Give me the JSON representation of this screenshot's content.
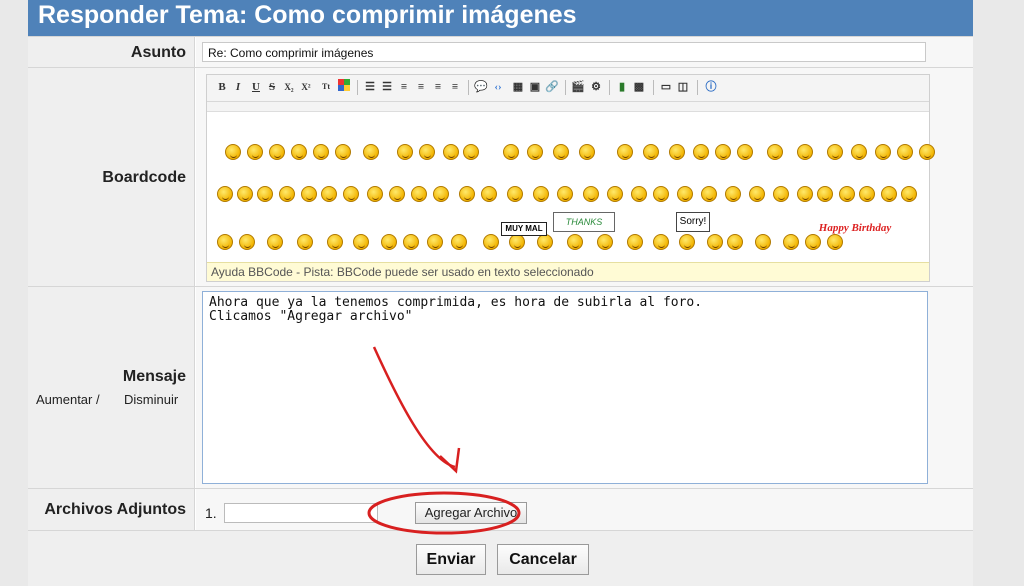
{
  "title": "Responder Tema: Como comprimir imágenes",
  "subject": {
    "label": "Asunto",
    "value": "Re: Como comprimir imágenes"
  },
  "boardcode": {
    "label": "Boardcode",
    "toolbar": [
      "B",
      "I",
      "U",
      "S",
      "X₂",
      "X²",
      "Tt",
      "Color",
      "Lista",
      "Lista num",
      "Izq",
      "Centro",
      "Der",
      "Just",
      "Cita",
      "Código",
      "Tabla",
      "Imagen",
      "Enlace",
      "Video",
      "Flash",
      "Marquee",
      "Spoiler",
      "Tabla2",
      "Ayuda"
    ],
    "smiley_count": 72,
    "stickers": [
      "MUY MAL",
      "THANKS",
      "Sorry!",
      "Happy Birthday"
    ],
    "help": "Ayuda BBCode - Pista: BBCode puede ser usado en texto seleccionado"
  },
  "message": {
    "label": "Mensaje",
    "links": {
      "increase": "Aumentar /",
      "decrease": "Disminuir"
    },
    "lines": [
      "Ahora que ya la tenemos comprimida, es hora de subirla al foro.",
      "",
      "Clicamos \"Agregar archivo\""
    ]
  },
  "attachments": {
    "label": "Archivos Adjuntos",
    "index": "1.",
    "add_button": "Agregar Archivo"
  },
  "actions": {
    "submit": "Enviar",
    "cancel": "Cancelar"
  },
  "annotation": {
    "color": "#d82020"
  }
}
